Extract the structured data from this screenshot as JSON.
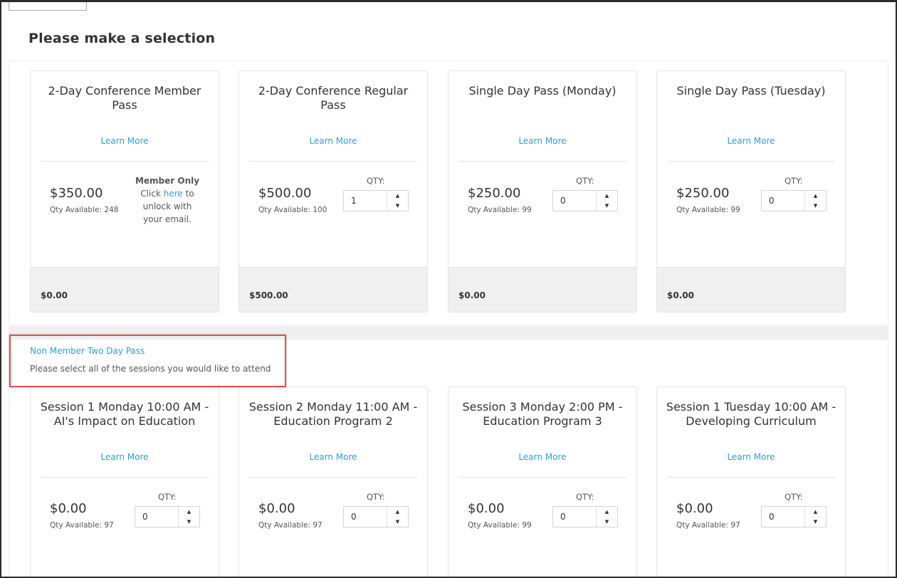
{
  "page": {
    "title": "Please make a selection"
  },
  "passes": [
    {
      "title": "2-Day Conference Member Pass",
      "learn_more": "Learn More",
      "price": "$350.00",
      "qty_available": "Qty Available: 248",
      "member_only": {
        "title": "Member Only",
        "text_before": "Click ",
        "link": "here",
        "text_after": " to unlock with your email."
      },
      "total": "$0.00"
    },
    {
      "title": "2-Day Conference Regular Pass",
      "learn_more": "Learn More",
      "price": "$500.00",
      "qty_available": "Qty Available: 100",
      "qty_label": "QTY:",
      "qty_value": "1",
      "total": "$500.00"
    },
    {
      "title": "Single Day Pass (Monday)",
      "learn_more": "Learn More",
      "price": "$250.00",
      "qty_available": "Qty Available: 99",
      "qty_label": "QTY:",
      "qty_value": "0",
      "total": "$0.00"
    },
    {
      "title": "Single Day Pass (Tuesday)",
      "learn_more": "Learn More",
      "price": "$250.00",
      "qty_available": "Qty Available: 99",
      "qty_label": "QTY:",
      "qty_value": "0",
      "total": "$0.00"
    }
  ],
  "sessions_section": {
    "link": "Non Member Two Day Pass",
    "description": "Please select all of the sessions you would like to attend"
  },
  "sessions": [
    {
      "title": "Session 1 Monday 10:00 AM - AI's Impact on Education",
      "learn_more": "Learn More",
      "price": "$0.00",
      "qty_available": "Qty Available: 97",
      "qty_label": "QTY:",
      "qty_value": "0"
    },
    {
      "title": "Session 2 Monday 11:00 AM - Education Program 2",
      "learn_more": "Learn More",
      "price": "$0.00",
      "qty_available": "Qty Available: 97",
      "qty_label": "QTY:",
      "qty_value": "0"
    },
    {
      "title": "Session 3 Monday 2:00 PM - Education Program 3",
      "learn_more": "Learn More",
      "price": "$0.00",
      "qty_available": "Qty Available: 99",
      "qty_label": "QTY:",
      "qty_value": "0"
    },
    {
      "title": "Session 1 Tuesday 10:00 AM - Developing Curriculum",
      "learn_more": "Learn More",
      "price": "$0.00",
      "qty_available": "Qty Available: 97",
      "qty_label": "QTY:",
      "qty_value": "0"
    }
  ],
  "icons": {
    "step_up": "triangle-up-icon",
    "step_down": "triangle-down-icon"
  },
  "colors": {
    "link": "#2f9fd0",
    "highlight": "#e05050",
    "footer_bg": "#f0f0f0"
  }
}
